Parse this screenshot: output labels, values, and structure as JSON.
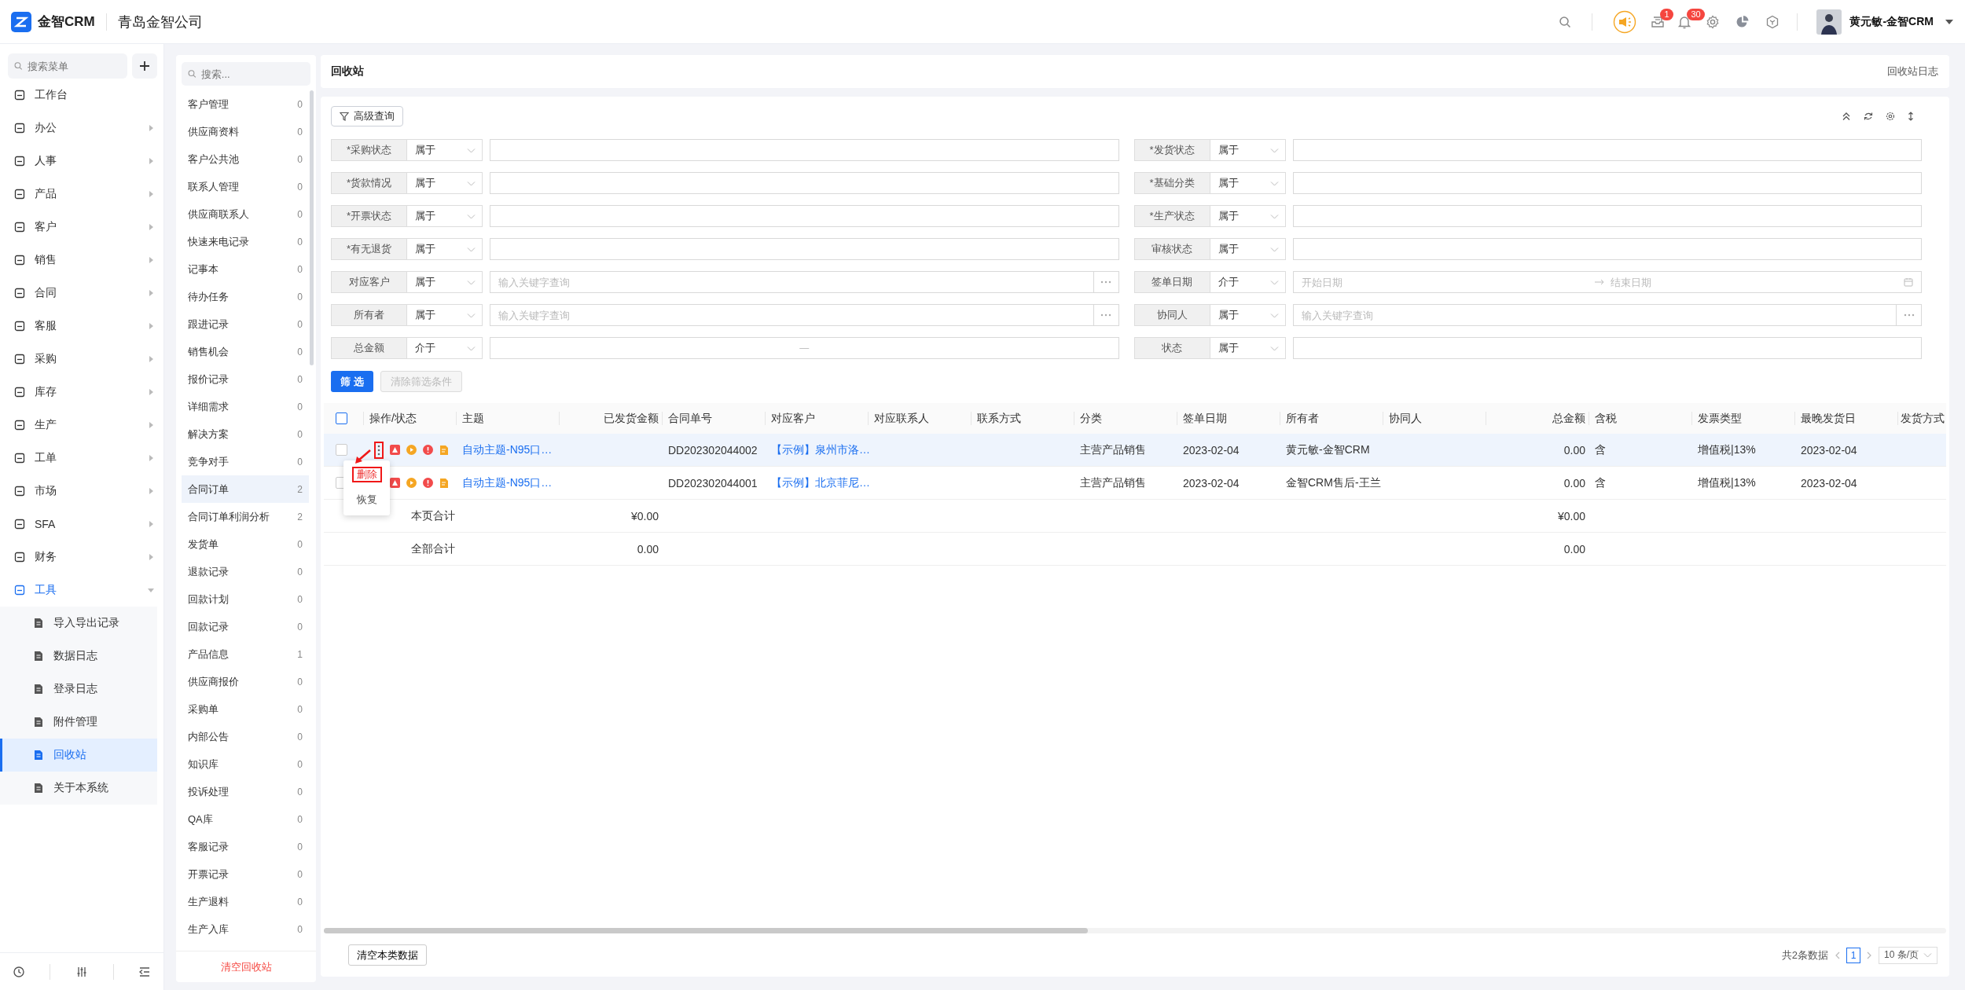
{
  "topbar": {
    "brand": "金智CRM",
    "company": "青岛金智公司",
    "notifications": [
      {
        "kind": "inbox",
        "badge": "1"
      },
      {
        "kind": "bell",
        "badge": "30"
      }
    ],
    "user": "黄元敏-金智CRM"
  },
  "sidebar": {
    "search_placeholder": "搜索菜单",
    "items": [
      {
        "label": "工作台",
        "kind": "link",
        "selected": false
      },
      {
        "label": "办公",
        "kind": "group",
        "expanded": false,
        "selected": false
      },
      {
        "label": "人事",
        "kind": "group",
        "expanded": false,
        "selected": false
      },
      {
        "label": "产品",
        "kind": "group",
        "expanded": false,
        "selected": false
      },
      {
        "label": "客户",
        "kind": "group",
        "expanded": false,
        "selected": false
      },
      {
        "label": "销售",
        "kind": "group",
        "expanded": false,
        "selected": false
      },
      {
        "label": "合同",
        "kind": "group",
        "expanded": false,
        "selected": false
      },
      {
        "label": "客服",
        "kind": "group",
        "expanded": false,
        "selected": false
      },
      {
        "label": "采购",
        "kind": "group",
        "expanded": false,
        "selected": false
      },
      {
        "label": "库存",
        "kind": "group",
        "expanded": false,
        "selected": false
      },
      {
        "label": "生产",
        "kind": "group",
        "expanded": false,
        "selected": false
      },
      {
        "label": "工单",
        "kind": "group",
        "expanded": false,
        "selected": false
      },
      {
        "label": "市场",
        "kind": "group",
        "expanded": false,
        "selected": false
      },
      {
        "label": "SFA",
        "kind": "group",
        "expanded": false,
        "selected": false
      },
      {
        "label": "财务",
        "kind": "group",
        "expanded": false,
        "selected": false
      },
      {
        "label": "工具",
        "kind": "group",
        "expanded": true,
        "selected": false,
        "children": [
          {
            "label": "导入导出记录",
            "selected": false
          },
          {
            "label": "数据日志",
            "selected": false
          },
          {
            "label": "登录日志",
            "selected": false
          },
          {
            "label": "附件管理",
            "selected": false
          },
          {
            "label": "回收站",
            "selected": true
          },
          {
            "label": "关于本系统",
            "selected": false
          }
        ]
      }
    ]
  },
  "modules": {
    "search_placeholder": "搜索...",
    "items": [
      {
        "label": "客户管理",
        "count": "0",
        "selected": false
      },
      {
        "label": "供应商资料",
        "count": "0",
        "selected": false
      },
      {
        "label": "客户公共池",
        "count": "0",
        "selected": false
      },
      {
        "label": "联系人管理",
        "count": "0",
        "selected": false
      },
      {
        "label": "供应商联系人",
        "count": "0",
        "selected": false
      },
      {
        "label": "快速来电记录",
        "count": "0",
        "selected": false
      },
      {
        "label": "记事本",
        "count": "0",
        "selected": false
      },
      {
        "label": "待办任务",
        "count": "0",
        "selected": false
      },
      {
        "label": "跟进记录",
        "count": "0",
        "selected": false
      },
      {
        "label": "销售机会",
        "count": "0",
        "selected": false
      },
      {
        "label": "报价记录",
        "count": "0",
        "selected": false
      },
      {
        "label": "详细需求",
        "count": "0",
        "selected": false
      },
      {
        "label": "解决方案",
        "count": "0",
        "selected": false
      },
      {
        "label": "竞争对手",
        "count": "0",
        "selected": false
      },
      {
        "label": "合同订单",
        "count": "2",
        "selected": true
      },
      {
        "label": "合同订单利润分析",
        "count": "2",
        "selected": false
      },
      {
        "label": "发货单",
        "count": "0",
        "selected": false
      },
      {
        "label": "退款记录",
        "count": "0",
        "selected": false
      },
      {
        "label": "回款计划",
        "count": "0",
        "selected": false
      },
      {
        "label": "回款记录",
        "count": "0",
        "selected": false
      },
      {
        "label": "产品信息",
        "count": "1",
        "selected": false
      },
      {
        "label": "供应商报价",
        "count": "0",
        "selected": false
      },
      {
        "label": "采购单",
        "count": "0",
        "selected": false
      },
      {
        "label": "内部公告",
        "count": "0",
        "selected": false
      },
      {
        "label": "知识库",
        "count": "0",
        "selected": false
      },
      {
        "label": "投诉处理",
        "count": "0",
        "selected": false
      },
      {
        "label": "QA库",
        "count": "0",
        "selected": false
      },
      {
        "label": "客服记录",
        "count": "0",
        "selected": false
      },
      {
        "label": "开票记录",
        "count": "0",
        "selected": false
      },
      {
        "label": "生产退料",
        "count": "0",
        "selected": false
      },
      {
        "label": "生产入库",
        "count": "0",
        "selected": false
      }
    ],
    "clear_button": "清空回收站"
  },
  "page": {
    "title": "回收站",
    "log_link": "回收站日志"
  },
  "filter": {
    "advanced_button": "高级查询",
    "fields": [
      {
        "label": "*采购状态",
        "operator": "属于",
        "kind": "text"
      },
      {
        "label": "*发货状态",
        "operator": "属于",
        "kind": "text"
      },
      {
        "label": "*货款情况",
        "operator": "属于",
        "kind": "text"
      },
      {
        "label": "*基础分类",
        "operator": "属于",
        "kind": "text"
      },
      {
        "label": "*开票状态",
        "operator": "属于",
        "kind": "text"
      },
      {
        "label": "*生产状态",
        "operator": "属于",
        "kind": "text"
      },
      {
        "label": "*有无退货",
        "operator": "属于",
        "kind": "text"
      },
      {
        "label": "审核状态",
        "operator": "属于",
        "kind": "text"
      },
      {
        "label": "对应客户",
        "operator": "属于",
        "kind": "lookup",
        "placeholder": "输入关键字查询"
      },
      {
        "label": "签单日期",
        "operator": "介于",
        "kind": "daterange",
        "start_placeholder": "开始日期",
        "end_placeholder": "结束日期"
      },
      {
        "label": "所有者",
        "operator": "属于",
        "kind": "lookup",
        "placeholder": "输入关键字查询"
      },
      {
        "label": "协同人",
        "operator": "属于",
        "kind": "lookup",
        "placeholder": "输入关键字查询"
      },
      {
        "label": "总金额",
        "operator": "介于",
        "kind": "range",
        "separator": "—"
      },
      {
        "label": "状态",
        "operator": "属于",
        "kind": "text"
      }
    ],
    "buttons": [
      {
        "label": "筛 选",
        "kind": "primary",
        "disabled": false
      },
      {
        "label": "清除筛选条件",
        "kind": "secondary",
        "disabled": true
      }
    ]
  },
  "table": {
    "select_all": {
      "checked": false
    },
    "columns": [
      {
        "label": "操作/状态",
        "kind": "actions"
      },
      {
        "label": "主题",
        "kind": "link"
      },
      {
        "label": "已发货金额",
        "kind": "number"
      },
      {
        "label": "合同单号",
        "kind": "text"
      },
      {
        "label": "对应客户",
        "kind": "link"
      },
      {
        "label": "对应联系人",
        "kind": "text"
      },
      {
        "label": "联系方式",
        "kind": "text"
      },
      {
        "label": "分类",
        "kind": "text"
      },
      {
        "label": "签单日期",
        "kind": "text"
      },
      {
        "label": "所有者",
        "kind": "text"
      },
      {
        "label": "协同人",
        "kind": "text"
      },
      {
        "label": "总金额",
        "kind": "number"
      },
      {
        "label": "含税",
        "kind": "text"
      },
      {
        "label": "发票类型",
        "kind": "text"
      },
      {
        "label": "最晚发货日",
        "kind": "text"
      },
      {
        "label": "发货方式",
        "kind": "text"
      }
    ],
    "rows": [
      {
        "kind": "record",
        "checked": false,
        "highlighted": true,
        "annotated": true,
        "cells": [
          null,
          "自动主题-N95口…",
          null,
          "DD202302044002",
          "【示例】泉州市洛…",
          null,
          null,
          "主营产品销售",
          "2023-02-04",
          "黄元敏-金智CRM",
          null,
          "0.00",
          "含",
          "增值税|13%",
          "2023-02-04",
          null
        ],
        "menu": {
          "items": [
            {
              "label": "删除",
              "annotated": true
            },
            {
              "label": "恢复",
              "annotated": false
            }
          ]
        }
      },
      {
        "kind": "record",
        "checked": false,
        "highlighted": false,
        "cells": [
          null,
          "自动主题-N95口…",
          null,
          "DD202302044001",
          "【示例】北京菲尼…",
          null,
          null,
          "主营产品销售",
          "2023-02-04",
          "金智CRM售后-王兰",
          null,
          "0.00",
          "含",
          "增值税|13%",
          "2023-02-04",
          null
        ]
      },
      {
        "kind": "summary",
        "highlighted": false,
        "cells": [
          "本页合计",
          null,
          "¥0.00",
          null,
          null,
          null,
          null,
          null,
          null,
          null,
          null,
          "¥0.00",
          null,
          null,
          null,
          null
        ]
      },
      {
        "kind": "summary",
        "highlighted": false,
        "cells": [
          "全部合计",
          null,
          "0.00",
          null,
          null,
          null,
          null,
          null,
          null,
          null,
          null,
          "0.00",
          null,
          null,
          null,
          null
        ]
      }
    ]
  },
  "footer": {
    "clear_button": "清空本类数据",
    "total": "共2条数据",
    "pages": [
      {
        "label": "1",
        "selected": true
      }
    ],
    "page_size": "10 条/页"
  }
}
